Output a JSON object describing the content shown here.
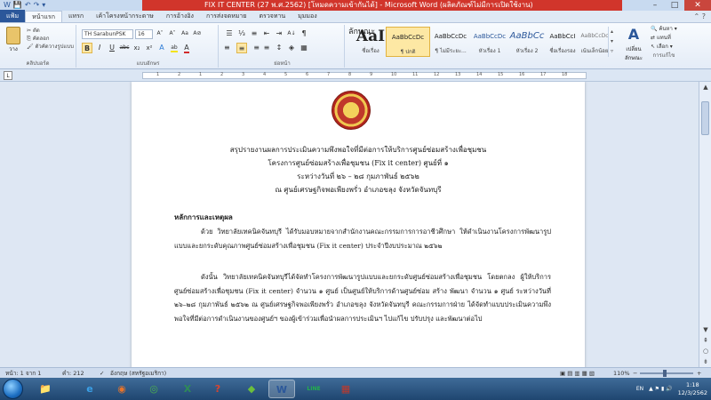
{
  "window": {
    "title": "FIX IT CENTER (27 พ.ศ.2562) [โหมดความเข้ากันได้] - Microsoft Word (ผลิตภัณฑ์ไม่มีการเปิดใช้งาน)",
    "qat": [
      "W",
      "💾",
      "↶",
      "↷",
      "▾"
    ],
    "minimize": "–",
    "maximize": "□",
    "close": "✕"
  },
  "tabs": [
    {
      "label": "แฟ้ม",
      "kind": "file"
    },
    {
      "label": "หน้าแรก",
      "kind": "active"
    },
    {
      "label": "แทรก",
      "kind": "normal"
    },
    {
      "label": "เค้าโครงหน้ากระดาษ",
      "kind": "normal"
    },
    {
      "label": "การอ้างอิง",
      "kind": "normal"
    },
    {
      "label": "การส่งจดหมาย",
      "kind": "normal"
    },
    {
      "label": "ตรวจทาน",
      "kind": "normal"
    },
    {
      "label": "มุมมอง",
      "kind": "normal"
    }
  ],
  "ribbon": {
    "clipboard": {
      "paste": "วาง",
      "cut": "ตัด",
      "copy": "คัดลอก",
      "format_painter": "ตัวคัดวางรูปแบบ",
      "label": "คลิปบอร์ด"
    },
    "font": {
      "name": "TH SarabunPSK",
      "size": "16",
      "grow": "A˄",
      "shrink": "A˅",
      "case": "Aa",
      "clear": "A⊘",
      "bold": "B",
      "italic": "I",
      "underline": "U",
      "strike": "abc",
      "sub": "x₂",
      "sup": "x²",
      "effects": "A",
      "highlight": "ab",
      "color": "A",
      "label": "แบบอักษร"
    },
    "paragraph": {
      "bullets": "☰",
      "numbering": "⅓",
      "multilevel": "≡",
      "decrease_indent": "⇤",
      "increase_indent": "⇥",
      "sort": "A↓",
      "show_marks": "¶",
      "align_left": "≡",
      "center": "≡",
      "align_right": "≡",
      "justify": "≡",
      "line_spacing": "↕",
      "shading": "◈",
      "borders": "▦",
      "label": "ย่อหน้า"
    },
    "styles": {
      "items": [
        {
          "preview": "AaI",
          "name": "ชื่อเรื่อง",
          "selected": false,
          "big": true
        },
        {
          "preview": "AaBbCcDc",
          "name": "¶ ปกติ",
          "selected": true,
          "big": false
        },
        {
          "preview": "AaBbCcDc",
          "name": "¶ ไม่มีระยะ...",
          "selected": false,
          "big": false
        },
        {
          "preview": "AaBbCcDc",
          "name": "หัวเรื่อง 1",
          "selected": false,
          "big": false
        },
        {
          "preview": "AaBbCc",
          "name": "หัวเรื่อง 2",
          "selected": false,
          "big": false
        },
        {
          "preview": "AaBbCcI",
          "name": "ชื่อเรื่องรอง",
          "selected": false,
          "big": false
        },
        {
          "preview": "AaBbCcDc",
          "name": "เน้นเล็กน้อย",
          "selected": false,
          "big": false
        }
      ],
      "label": "ลักษณะ"
    },
    "change_styles": "เปลี่ยน ลักษณะ",
    "editing": {
      "find": "ค้นหา ▾",
      "replace": "แทนที่",
      "select": "เลือก ▾",
      "label": "การแก้ไข"
    }
  },
  "ruler": {
    "ticks": [
      "1",
      "2",
      "1",
      "2",
      "3",
      "4",
      "5",
      "6",
      "7",
      "8",
      "9",
      "10",
      "11",
      "12",
      "13",
      "14",
      "15",
      "16",
      "17",
      "18"
    ]
  },
  "document": {
    "heading": [
      "สรุปรายงานผลการประเมินความพึงพอใจที่มีต่อการให้บริการศูนย์ซ่อมสร้างเพื่อชุมชน",
      "โครงการศูนย์ซ่อมสร้างเพื่อชุมชน (Fix it center) ศูนย์ที่ ๑",
      "ระหว่างวันที่ ๒๖ – ๒๘ กุมภาพันธ์ ๒๕๖๒",
      "ณ ศูนย์เศรษฐกิจพอเพียงพรั่ว อำเภอขลุง จังหวัดจันทบุรี"
    ],
    "section_title": "หลักการและเหตุผล",
    "para1": "ด้วย วิทยาลัยเทคนิคจันทบุรี ได้รับมอบหมายจากสำนักงานคณะกรรมการการอาชีวศึกษา ให้ดำเนินงานโครงการพัฒนารูปแบบและยกระดับคุณภาพศูนย์ซ่อมสร้างเพื่อชุมชน (Fix it center) ประจำปีงบประมาณ ๒๕๖๒",
    "para2": "ดังนั้น วิทยาลัยเทคนิคจันทบุรีได้จัดทำโครงการพัฒนารูปแบบและยกระดับศูนย์ซ่อมสร้างเพื่อชุมชน โดยตกลง ผู้ให้บริการศูนย์ซ่อมสร้างเพื่อชุมชน (Fix it center) จำนวน ๑ ศูนย์ เป็นศูนย์ให้บริการด้านศูนย์ซ่อม สร้าง พัฒนา จำนวน ๑ ศูนย์ ระหว่างวันที่ ๒๖–๒๘ กุมภาพันธ์ ๒๕๖๒ ณ ศูนย์เศรษฐกิจพอเพียงพรั่ว อำเภอขลุง จังหวัดจันทบุรี คณะกรรมการฝ่าย ได้จัดทำแบบประเมินความพึงพอใจที่มีต่อการดำเนินงานของศูนย์ฯ ของผู้เข้าร่วมเพื่อนำผลการประเมินฯ ไปแก้ไข ปรับปรุง และพัฒนาต่อไป"
  },
  "statusbar": {
    "page": "หน้า: 1 จาก 1",
    "words": "คำ: 212",
    "language": "อังกฤษ (สหรัฐอเมริกา)",
    "zoom": "110%",
    "zoom_minus": "−",
    "zoom_plus": "+"
  },
  "taskbar": {
    "apps": [
      {
        "name": "folder",
        "glyph": "📁",
        "color": "#f2c14e",
        "active": false
      },
      {
        "name": "internet-explorer",
        "glyph": "e",
        "color": "#3aa0e8",
        "active": false
      },
      {
        "name": "firefox",
        "glyph": "◉",
        "color": "#e8742a",
        "active": false
      },
      {
        "name": "chrome",
        "glyph": "◎",
        "color": "#4caf50",
        "active": false
      },
      {
        "name": "excel-tool",
        "glyph": "X",
        "color": "#2e8b57",
        "active": false
      },
      {
        "name": "app-red",
        "glyph": "?",
        "color": "#d9442f",
        "active": false
      },
      {
        "name": "app-green",
        "glyph": "◆",
        "color": "#6cbf3c",
        "active": false
      },
      {
        "name": "word",
        "glyph": "W",
        "color": "#2b579a",
        "active": true
      },
      {
        "name": "line",
        "glyph": "LINE",
        "color": "#22b14c",
        "active": false
      },
      {
        "name": "app-calendar",
        "glyph": "▦",
        "color": "#c0392b",
        "active": false
      }
    ],
    "tray_lang": "EN",
    "time": "1:18",
    "date": "12/3/2562"
  }
}
